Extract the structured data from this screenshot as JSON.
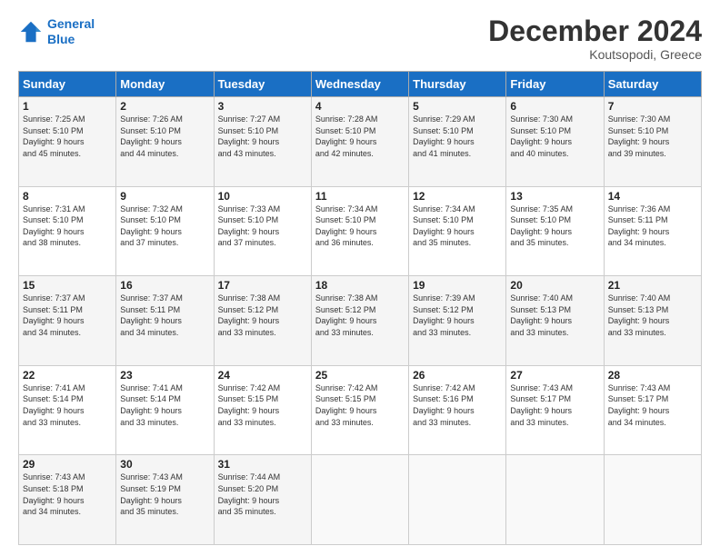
{
  "logo": {
    "line1": "General",
    "line2": "Blue"
  },
  "title": "December 2024",
  "location": "Koutsopodi, Greece",
  "header_days": [
    "Sunday",
    "Monday",
    "Tuesday",
    "Wednesday",
    "Thursday",
    "Friday",
    "Saturday"
  ],
  "weeks": [
    [
      {
        "day": "1",
        "info": "Sunrise: 7:25 AM\nSunset: 5:10 PM\nDaylight: 9 hours\nand 45 minutes."
      },
      {
        "day": "2",
        "info": "Sunrise: 7:26 AM\nSunset: 5:10 PM\nDaylight: 9 hours\nand 44 minutes."
      },
      {
        "day": "3",
        "info": "Sunrise: 7:27 AM\nSunset: 5:10 PM\nDaylight: 9 hours\nand 43 minutes."
      },
      {
        "day": "4",
        "info": "Sunrise: 7:28 AM\nSunset: 5:10 PM\nDaylight: 9 hours\nand 42 minutes."
      },
      {
        "day": "5",
        "info": "Sunrise: 7:29 AM\nSunset: 5:10 PM\nDaylight: 9 hours\nand 41 minutes."
      },
      {
        "day": "6",
        "info": "Sunrise: 7:30 AM\nSunset: 5:10 PM\nDaylight: 9 hours\nand 40 minutes."
      },
      {
        "day": "7",
        "info": "Sunrise: 7:30 AM\nSunset: 5:10 PM\nDaylight: 9 hours\nand 39 minutes."
      }
    ],
    [
      {
        "day": "8",
        "info": "Sunrise: 7:31 AM\nSunset: 5:10 PM\nDaylight: 9 hours\nand 38 minutes."
      },
      {
        "day": "9",
        "info": "Sunrise: 7:32 AM\nSunset: 5:10 PM\nDaylight: 9 hours\nand 37 minutes."
      },
      {
        "day": "10",
        "info": "Sunrise: 7:33 AM\nSunset: 5:10 PM\nDaylight: 9 hours\nand 37 minutes."
      },
      {
        "day": "11",
        "info": "Sunrise: 7:34 AM\nSunset: 5:10 PM\nDaylight: 9 hours\nand 36 minutes."
      },
      {
        "day": "12",
        "info": "Sunrise: 7:34 AM\nSunset: 5:10 PM\nDaylight: 9 hours\nand 35 minutes."
      },
      {
        "day": "13",
        "info": "Sunrise: 7:35 AM\nSunset: 5:10 PM\nDaylight: 9 hours\nand 35 minutes."
      },
      {
        "day": "14",
        "info": "Sunrise: 7:36 AM\nSunset: 5:11 PM\nDaylight: 9 hours\nand 34 minutes."
      }
    ],
    [
      {
        "day": "15",
        "info": "Sunrise: 7:37 AM\nSunset: 5:11 PM\nDaylight: 9 hours\nand 34 minutes."
      },
      {
        "day": "16",
        "info": "Sunrise: 7:37 AM\nSunset: 5:11 PM\nDaylight: 9 hours\nand 34 minutes."
      },
      {
        "day": "17",
        "info": "Sunrise: 7:38 AM\nSunset: 5:12 PM\nDaylight: 9 hours\nand 33 minutes."
      },
      {
        "day": "18",
        "info": "Sunrise: 7:38 AM\nSunset: 5:12 PM\nDaylight: 9 hours\nand 33 minutes."
      },
      {
        "day": "19",
        "info": "Sunrise: 7:39 AM\nSunset: 5:12 PM\nDaylight: 9 hours\nand 33 minutes."
      },
      {
        "day": "20",
        "info": "Sunrise: 7:40 AM\nSunset: 5:13 PM\nDaylight: 9 hours\nand 33 minutes."
      },
      {
        "day": "21",
        "info": "Sunrise: 7:40 AM\nSunset: 5:13 PM\nDaylight: 9 hours\nand 33 minutes."
      }
    ],
    [
      {
        "day": "22",
        "info": "Sunrise: 7:41 AM\nSunset: 5:14 PM\nDaylight: 9 hours\nand 33 minutes."
      },
      {
        "day": "23",
        "info": "Sunrise: 7:41 AM\nSunset: 5:14 PM\nDaylight: 9 hours\nand 33 minutes."
      },
      {
        "day": "24",
        "info": "Sunrise: 7:42 AM\nSunset: 5:15 PM\nDaylight: 9 hours\nand 33 minutes."
      },
      {
        "day": "25",
        "info": "Sunrise: 7:42 AM\nSunset: 5:15 PM\nDaylight: 9 hours\nand 33 minutes."
      },
      {
        "day": "26",
        "info": "Sunrise: 7:42 AM\nSunset: 5:16 PM\nDaylight: 9 hours\nand 33 minutes."
      },
      {
        "day": "27",
        "info": "Sunrise: 7:43 AM\nSunset: 5:17 PM\nDaylight: 9 hours\nand 33 minutes."
      },
      {
        "day": "28",
        "info": "Sunrise: 7:43 AM\nSunset: 5:17 PM\nDaylight: 9 hours\nand 34 minutes."
      }
    ],
    [
      {
        "day": "29",
        "info": "Sunrise: 7:43 AM\nSunset: 5:18 PM\nDaylight: 9 hours\nand 34 minutes."
      },
      {
        "day": "30",
        "info": "Sunrise: 7:43 AM\nSunset: 5:19 PM\nDaylight: 9 hours\nand 35 minutes."
      },
      {
        "day": "31",
        "info": "Sunrise: 7:44 AM\nSunset: 5:20 PM\nDaylight: 9 hours\nand 35 minutes."
      },
      null,
      null,
      null,
      null
    ]
  ]
}
